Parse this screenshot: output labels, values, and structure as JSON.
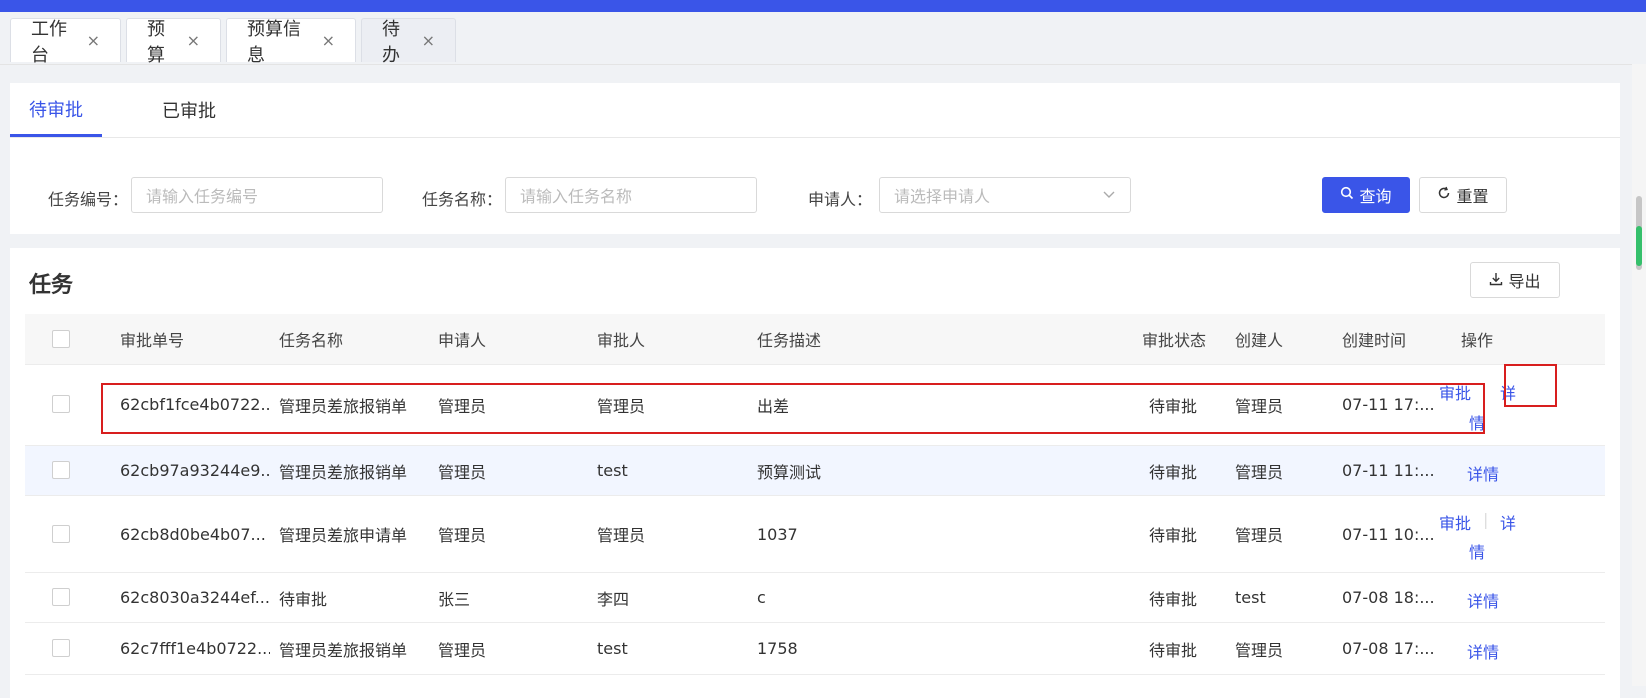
{
  "tabs": [
    {
      "label": "工作台",
      "close": "×"
    },
    {
      "label": "预算",
      "close": "×"
    },
    {
      "label": "预算信息",
      "close": "×"
    },
    {
      "label": "待办",
      "close": "×"
    }
  ],
  "subtabs": [
    "待审批",
    "已审批"
  ],
  "filters": {
    "task_no": {
      "label": "任务编号：",
      "placeholder": "请输入任务编号"
    },
    "task_name": {
      "label": "任务名称：",
      "placeholder": "请输入任务名称"
    },
    "applicant": {
      "label": "申请人：",
      "placeholder": "请选择申请人"
    }
  },
  "buttons": {
    "query": "查询",
    "reset": "重置",
    "export": "导出"
  },
  "section_title": "任务",
  "columns": [
    "审批单号",
    "任务名称",
    "申请人",
    "审批人",
    "任务描述",
    "审批状态",
    "创建人",
    "创建时间",
    "操作"
  ],
  "rows": [
    {
      "id": "62cbf1fce4b0722...",
      "name": "管理员差旅报销单",
      "applicant": "管理员",
      "approver": "管理员",
      "desc": "出差",
      "status": "待审批",
      "creator": "管理员",
      "time": "07-11 17:...",
      "op_approve": "审批",
      "op_detail_1": "详",
      "op_detail_2": "情"
    },
    {
      "id": "62cb97a93244e9...",
      "name": "管理员差旅报销单",
      "applicant": "管理员",
      "approver": "test",
      "desc": "预算测试",
      "status": "待审批",
      "creator": "管理员",
      "time": "07-11 11:...",
      "op_detail": "详情"
    },
    {
      "id": "62cb8d0be4b07...",
      "name": "管理员差旅申请单",
      "applicant": "管理员",
      "approver": "管理员",
      "desc": "1037",
      "status": "待审批",
      "creator": "管理员",
      "time": "07-11 10:...",
      "op_approve": "审批",
      "op_sep": "|",
      "op_detail_1": "详",
      "op_detail_2": "情"
    },
    {
      "id": "62c8030a3244ef...",
      "name": "待审批",
      "applicant": "张三",
      "approver": "李四",
      "desc": "c",
      "status": "待审批",
      "creator": "test",
      "time": "07-08 18:...",
      "op_detail": "详情"
    },
    {
      "id": "62c7fff1e4b0722...",
      "name": "管理员差旅报销单",
      "applicant": "管理员",
      "approver": "test",
      "desc": "1758",
      "status": "待审批",
      "creator": "管理员",
      "time": "07-08 17:...",
      "op_detail": "详情"
    }
  ],
  "colors": {
    "primary": "#3a55e8",
    "highlight": "#d81e1e"
  }
}
